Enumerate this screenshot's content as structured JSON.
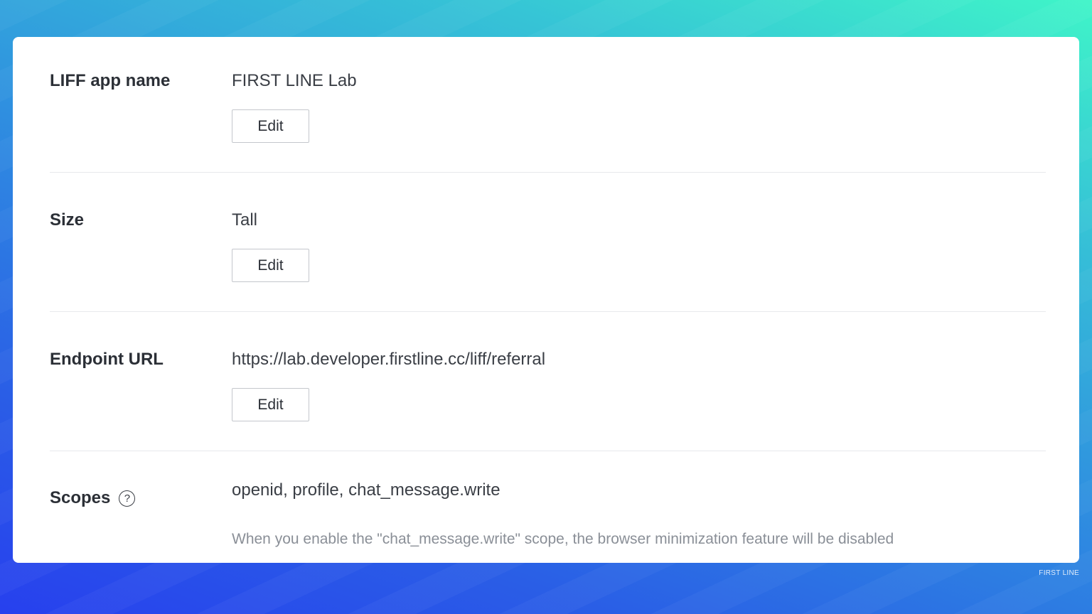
{
  "sections": [
    {
      "label": "LIFF app name",
      "value": "FIRST LINE Lab",
      "edit_label": "Edit"
    },
    {
      "label": "Size",
      "value": "Tall",
      "edit_label": "Edit"
    },
    {
      "label": "Endpoint URL",
      "value": "https://lab.developer.firstline.cc/liff/referral",
      "edit_label": "Edit"
    },
    {
      "label": "Scopes",
      "help_icon": "?",
      "value": "openid, profile, chat_message.write",
      "note": "When you enable the \"chat_message.write\" scope, the browser minimization feature will be disabled"
    }
  ],
  "watermark": "FIRST LINE"
}
